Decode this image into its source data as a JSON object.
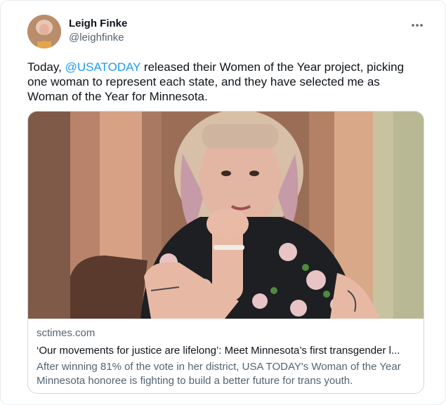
{
  "user": {
    "display_name": "Leigh Finke",
    "handle": "@leighfinke",
    "avatar_icon": "profile-photo"
  },
  "tweet": {
    "text_before_mention": "Today, ",
    "mention": "@USATODAY",
    "text_after_mention": " released their Women of the Year project, picking one woman to represent each state, and they have selected me as Woman of the Year for Minnesota.",
    "more_icon": "more-horizontal-icon"
  },
  "link_card": {
    "domain": "sctimes.com",
    "title": "‘Our movements for justice are lifelong’: Meet Minnesota’s first transgender l...",
    "description": "After winning 81% of the vote in her district, USA TODAY's Woman of the Year Minnesota honoree is fighting to build a better future for trans youth."
  },
  "colors": {
    "accent": "#1d9bf0",
    "text_primary": "#0f1419",
    "text_secondary": "#536471",
    "border": "#cfd9de"
  }
}
